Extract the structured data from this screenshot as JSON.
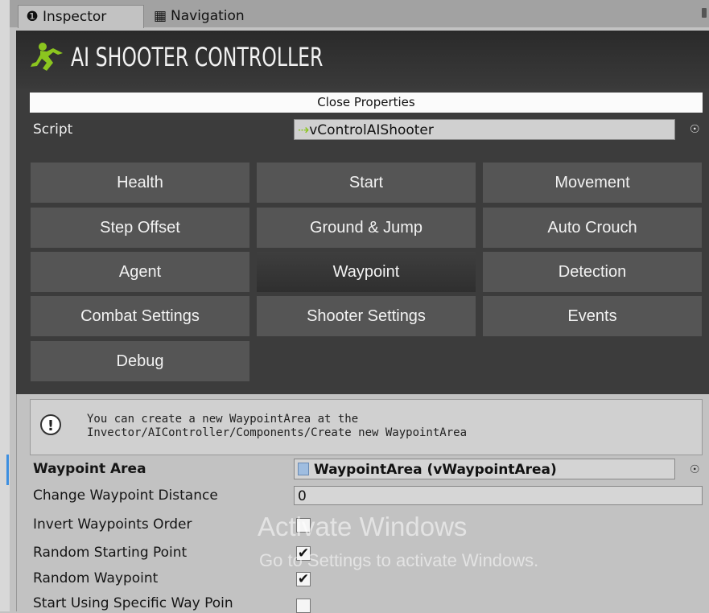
{
  "tabs": {
    "inspector_label": "Inspector",
    "navigation_label": "Navigation",
    "inspector_icon": "info-icon",
    "navigation_icon": "navigation-icon"
  },
  "header": {
    "title": "AI SHOOTER CONTROLLER",
    "logo_icon": "running-figure-logo"
  },
  "close_properties_label": "Close Properties",
  "script": {
    "label": "Script",
    "value": "vControlAIShooter"
  },
  "section_buttons": [
    "Health",
    "Start",
    "Movement",
    "Step Offset",
    "Ground & Jump",
    "Auto Crouch",
    "Agent",
    "Waypoint",
    "Detection",
    "Combat Settings",
    "Shooter Settings",
    "Events",
    "Debug"
  ],
  "selected_section": "Waypoint",
  "help_box": {
    "line1": "You can create a new WaypointArea at the",
    "line2": "Invector/AIController/Components/Create new WaypointArea"
  },
  "properties": {
    "waypoint_area_label": "Waypoint Area",
    "waypoint_area_value": "WaypointArea (vWaypointArea)",
    "change_distance_label": "Change Waypoint Distance",
    "change_distance_value": "0",
    "invert_order_label": "Invert Waypoints Order",
    "invert_order_checked": false,
    "random_start_label": "Random Starting Point",
    "random_start_checked": true,
    "random_waypoint_label": "Random Waypoint",
    "random_waypoint_checked": true,
    "start_specific_label": "Start Using Specific Way Poin",
    "start_specific_checked": false
  },
  "watermark": {
    "line1": "Activate Windows",
    "line2": "Go to Settings to activate Windows."
  },
  "colors": {
    "header_bg": "#2f2f2f",
    "button_bg": "#555555",
    "selected_button_bg": "#353535",
    "panel_bg": "#c2c2c2",
    "logo_green": "#8bc51f"
  }
}
